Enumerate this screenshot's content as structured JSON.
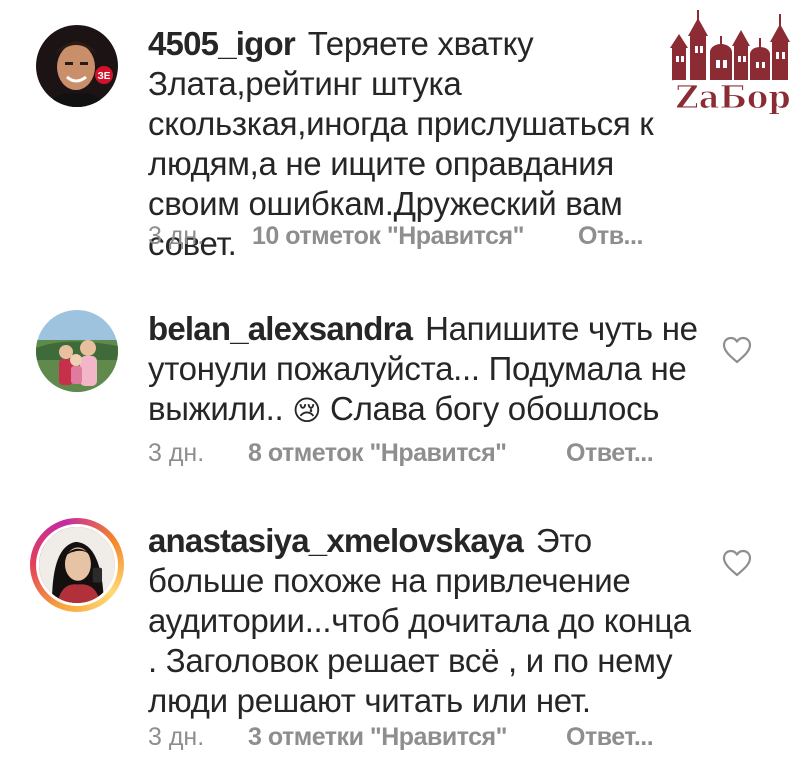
{
  "logo": {
    "text": "ZaБор",
    "color": "#8b2c34"
  },
  "colors": {
    "text": "#262626",
    "meta": "#8e8e8e",
    "heart": "#8e8e8e"
  },
  "comments": [
    {
      "username": "4505_igor",
      "text": "Теряете хватку Злата,рейтинг штука скользкая,иногда прислушаться к людям,а не ищите оправдания своим ошибкам.Дружеский вам совет.",
      "time": "3 дн.",
      "likes": "10 отметок \"Нравится\"",
      "reply": "Отв...",
      "heart_icon": ""
    },
    {
      "username": "belan_alexsandra",
      "text": "Напишите чуть не утонули пожалуйста... Подумала не выжили..",
      "emoji": "😢",
      "text_after": "Слава богу обошлось",
      "time": "3 дн.",
      "likes": "8 отметок \"Нравится\"",
      "reply": "Ответ...",
      "heart_icon": "heart-outline-icon"
    },
    {
      "username": "anastasiya_xmelovskaya",
      "text": "Это больше похоже на привлечение аудитории...чтоб дочитала до конца . Заголовок решает всё , и по нему люди решают читать или нет.",
      "time": "3 дн.",
      "likes": "3 отметки \"Нравится\"",
      "reply": "Ответ...",
      "heart_icon": "heart-outline-icon"
    }
  ]
}
